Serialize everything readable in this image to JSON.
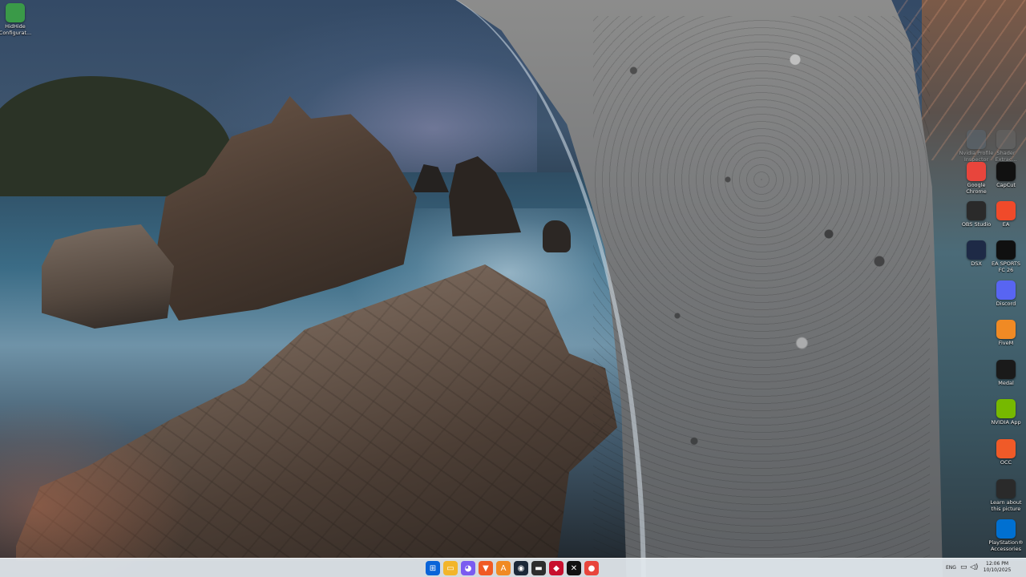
{
  "desktop_icons_left": [
    {
      "label": "HidHide\nConfigurat...",
      "icon": "hidhide-icon",
      "color": "#3a9a48"
    }
  ],
  "desktop_icons_right": [
    {
      "label": "Nvidia Profile\nInspector",
      "icon": "profile-inspector-icon",
      "color": "#5a6a78"
    },
    {
      "label": "Shader\nExtrac...",
      "icon": "extractor-icon",
      "color": "#6a6a6a"
    },
    {
      "label": "Google\nChrome",
      "icon": "chrome-icon",
      "color": "#e8453c"
    },
    {
      "label": "CapCut",
      "icon": "capcut-icon",
      "color": "#111111"
    },
    {
      "label": "OBS Studio",
      "icon": "obs-icon",
      "color": "#2a2a2a"
    },
    {
      "label": "EA",
      "icon": "ea-icon",
      "color": "#f04a2a"
    },
    {
      "label": "DSX",
      "icon": "dsx-icon",
      "color": "#1e2a46"
    },
    {
      "label": "EA SPORTS\nFC 26",
      "icon": "fc26-icon",
      "color": "#101010"
    },
    {
      "label": "Discord",
      "icon": "discord-icon",
      "color": "#5865f2"
    },
    {
      "label": "FiveM",
      "icon": "fivem-icon",
      "color": "#f08a24"
    },
    {
      "label": "Medal",
      "icon": "medal-icon",
      "color": "#1a1a1a"
    },
    {
      "label": "NVIDIA App",
      "icon": "nvidia-icon",
      "color": "#76b900"
    },
    {
      "label": "OCC",
      "icon": "occ-icon",
      "color": "#f05a28"
    },
    {
      "label": "Learn about\nthis picture",
      "icon": "learn-picture-icon",
      "color": "#2a2a2a"
    },
    {
      "label": "PlayStation®\nAccessories",
      "icon": "playstation-icon",
      "color": "#0070d1"
    }
  ],
  "taskbar": {
    "apps": [
      {
        "name": "start-button",
        "glyph": "⊞",
        "color": "#0a64d8"
      },
      {
        "name": "file-explorer-icon",
        "glyph": "▭",
        "color": "#f2b52a"
      },
      {
        "name": "copilot-icon",
        "glyph": "◕",
        "color": "#7a5cf0"
      },
      {
        "name": "brave-icon",
        "glyph": "▼",
        "color": "#f05a24"
      },
      {
        "name": "fivem-taskbar-icon",
        "glyph": "A",
        "color": "#f08a24"
      },
      {
        "name": "steam-icon",
        "glyph": "◉",
        "color": "#1b2838"
      },
      {
        "name": "terminal-icon",
        "glyph": "▬",
        "color": "#2d2d2d"
      },
      {
        "name": "game-app-icon",
        "glyph": "◆",
        "color": "#c8102e"
      },
      {
        "name": "capcut-taskbar-icon",
        "glyph": "✕",
        "color": "#111111"
      },
      {
        "name": "chrome-taskbar-icon",
        "glyph": "●",
        "color": "#e8453c"
      }
    ],
    "language": "ENG",
    "time": "12:06 PM",
    "date": "10/10/2025"
  }
}
